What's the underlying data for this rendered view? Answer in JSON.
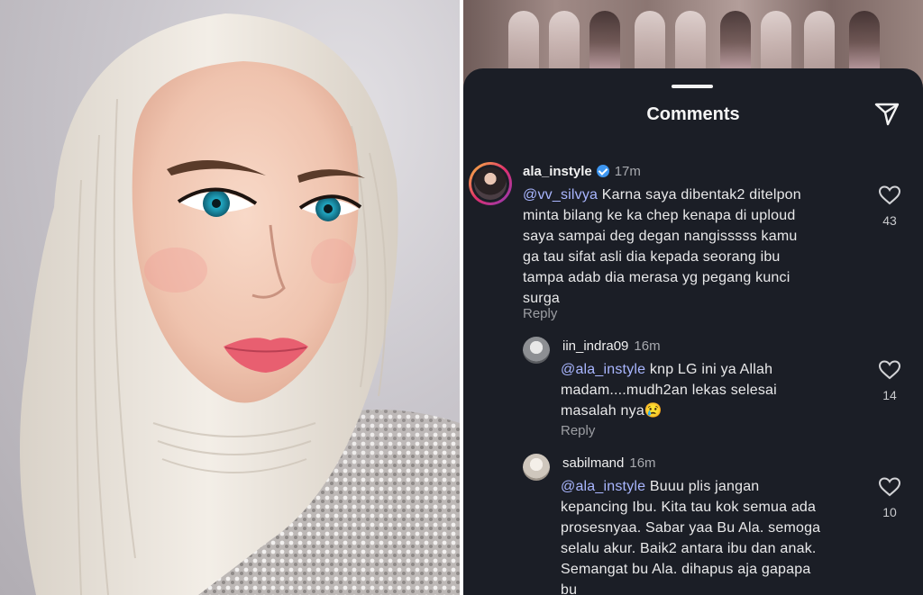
{
  "sheet": {
    "title": "Comments",
    "share_icon": "send-icon"
  },
  "comments": [
    {
      "username": "ala_instyle",
      "verified": true,
      "time": "17m",
      "mention": "@vv_silvya",
      "text": " Karna saya dibentak2 ditelpon\nminta  bilang ke ka chep kenapa di uploud\nsaya sampai deg degan nangisssss  kamu\nga tau sifat asli dia kepada seorang  ibu\ntampa adab dia merasa yg pegang kunci\nsurga",
      "reply_label": "Reply",
      "likes": "43"
    },
    {
      "username": "iin_indra09",
      "time": "16m",
      "mention": "@ala_instyle",
      "text": " knp LG ini ya Allah\nmadam....mudh2an lekas selesai\nmasalah nya😢",
      "reply_label": "Reply",
      "likes": "14"
    },
    {
      "username": "sabilmand",
      "time": "16m",
      "mention": "@ala_instyle",
      "text": " Buuu plis jangan\nkepancing Ibu. Kita tau kok semua ada\nprosesnyaa. Sabar yaa Bu Ala. semoga\nselalu akur. Baik2 antara ibu dan anak.\nSemangat bu Ala. dihapus aja gapapa\nbu",
      "likes": "10"
    }
  ],
  "icons": {
    "like": "heart-icon",
    "verified": "verified-badge-icon"
  }
}
